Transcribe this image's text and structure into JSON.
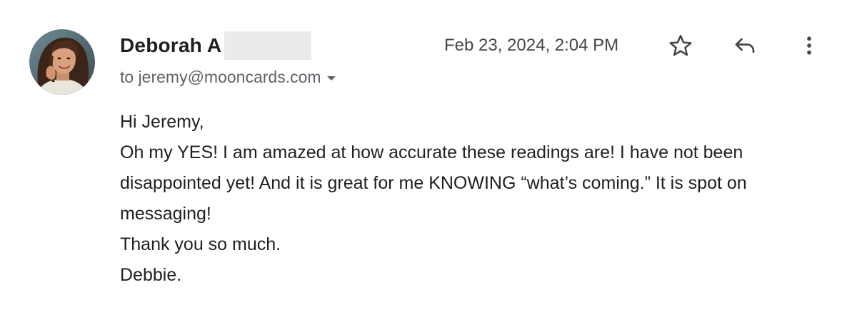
{
  "email": {
    "sender_name": "Deborah A",
    "recipient": "to jeremy@mooncards.com",
    "timestamp": "Feb 23, 2024, 2:04 PM",
    "body": {
      "greeting": "Hi Jeremy,",
      "paragraph": "Oh my YES! I am amazed at how accurate these readings are! I have not been disappointed yet! And it is great for me KNOWING “what’s coming.” It is spot on messaging!",
      "thanks": "Thank you so much.",
      "signature": "Debbie."
    }
  },
  "icons": {
    "star": "star-icon",
    "reply": "reply-icon",
    "more": "more-vert-icon",
    "recipient_caret": "chevron-down-icon"
  },
  "colors": {
    "redaction": "#ecebeb",
    "secondary_text": "#5f6368",
    "primary_text": "#1f1f1f"
  }
}
